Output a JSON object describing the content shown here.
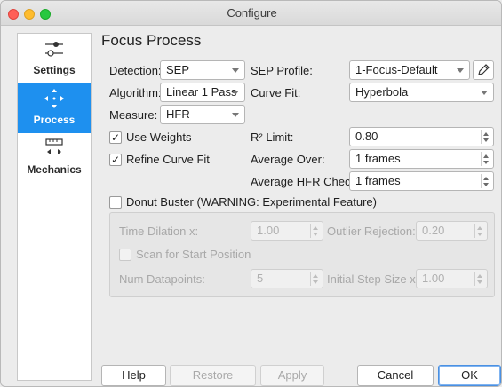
{
  "window": {
    "title": "Configure"
  },
  "sidebar": {
    "items": [
      {
        "label": "Settings",
        "icon": "sliders-icon",
        "active": false
      },
      {
        "label": "Process",
        "icon": "move-arrows-icon",
        "active": true
      },
      {
        "label": "Mechanics",
        "icon": "ruler-arrows-icon",
        "active": false
      }
    ]
  },
  "page": {
    "heading": "Focus Process"
  },
  "form": {
    "detection": {
      "label": "Detection:",
      "value": "SEP"
    },
    "sep_profile": {
      "label": "SEP Profile:",
      "value": "1-Focus-Default"
    },
    "algorithm": {
      "label": "Algorithm:",
      "value": "Linear 1 Pass"
    },
    "curve_fit": {
      "label": "Curve Fit:",
      "value": "Hyperbola"
    },
    "measure": {
      "label": "Measure:",
      "value": "HFR"
    },
    "use_weights": {
      "label": "Use Weights",
      "checked": true
    },
    "r2_limit": {
      "label": "R² Limit:",
      "value": "0.80"
    },
    "refine_curve_fit": {
      "label": "Refine Curve Fit",
      "checked": true
    },
    "average_over": {
      "label": "Average Over:",
      "value": "1 frames"
    },
    "average_hfr_check": {
      "label": "Average HFR Check:",
      "value": "1 frames"
    },
    "donut_buster": {
      "label": "Donut Buster (WARNING: Experimental Feature)",
      "checked": false
    }
  },
  "donut": {
    "time_dilation": {
      "label": "Time Dilation x:",
      "value": "1.00"
    },
    "outlier_rejection": {
      "label": "Outlier Rejection:",
      "value": "0.20"
    },
    "scan_start": {
      "label": "Scan for Start Position",
      "checked": false
    },
    "num_datapoints": {
      "label": "Num Datapoints:",
      "value": "5"
    },
    "initial_step": {
      "label": "Initial Step Size x:",
      "value": "1.00"
    }
  },
  "buttons": {
    "help": "Help",
    "restore_defaults": "Restore Defaults",
    "apply": "Apply",
    "cancel": "Cancel",
    "ok": "OK"
  }
}
